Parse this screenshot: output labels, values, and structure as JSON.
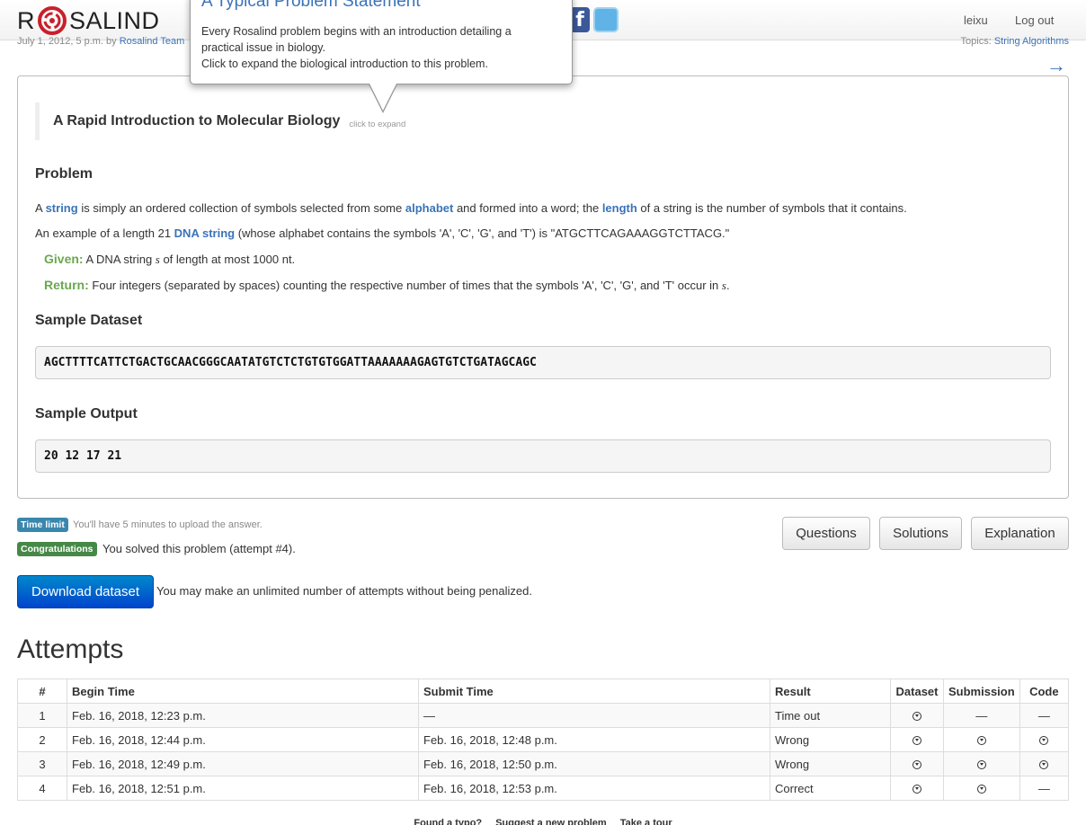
{
  "header": {
    "logo_left": "R",
    "logo_right": "SALIND",
    "user": "leixu",
    "logout": "Log out"
  },
  "meta": {
    "posted": "July 1, 2012, 5 p.m. by",
    "author": "Rosalind Team",
    "topics_label": "Topics:",
    "topics": "String Algorithms",
    "next_arrow": "→"
  },
  "tooltip": {
    "title": "A Typical Problem Statement",
    "line1": "Every Rosalind problem begins with an introduction detailing a",
    "line2": "practical issue in biology.",
    "line3": "Click to expand the biological introduction to this problem."
  },
  "problem": {
    "intro_title": "A Rapid Introduction to Molecular Biology",
    "intro_hint": "click to expand",
    "heading": "Problem",
    "p1": {
      "t1": "A ",
      "k1": "string",
      "t2": " is simply an ordered collection of symbols selected from some ",
      "k2": "alphabet",
      "t3": " and formed into a word; the ",
      "k3": "length",
      "t4": " of a string is the number of symbols that it contains."
    },
    "p2": {
      "t1": "An example of a length 21 ",
      "k1": "DNA string",
      "t2": " (whose alphabet contains the symbols 'A', 'C', 'G', and 'T') is \"ATGCTTCAGAAAGGTCTTACG.\""
    },
    "given_label": "Given:",
    "given_t1": " A DNA string ",
    "given_var": "s",
    "given_t2": " of length at most 1000 nt.",
    "return_label": "Return:",
    "return_t1": " Four integers (separated by spaces) counting the respective number of times that the symbols 'A', 'C', 'G', and 'T' occur in ",
    "return_var": "s",
    "return_t2": ".",
    "sample_dataset_heading": "Sample Dataset",
    "sample_dataset": "AGCTTTTCATTCTGACTGCAACGGGCAATATGTCTCTGTGTGGATTAAAAAAAGAGTGTCTGATAGCAGC",
    "sample_output_heading": "Sample Output",
    "sample_output": "20 12 17 21"
  },
  "status": {
    "time_limit_label": "Time limit",
    "time_limit_note": "You'll have 5 minutes to upload the answer.",
    "congrats_label": "Congratulations",
    "congrats_text": "You solved this problem (attempt #4)."
  },
  "buttons": {
    "questions": "Questions",
    "solutions": "Solutions",
    "explanation": "Explanation",
    "download": "Download dataset",
    "download_note": "You may make an unlimited number of attempts without being penalized."
  },
  "attempts": {
    "title": "Attempts",
    "headers": [
      "#",
      "Begin Time",
      "Submit Time",
      "Result",
      "Dataset",
      "Submission",
      "Code"
    ],
    "rows": [
      {
        "n": "1",
        "begin": "Feb. 16, 2018, 12:23 p.m.",
        "submit": "—",
        "result": "Time out",
        "submission": "—",
        "code": "—"
      },
      {
        "n": "2",
        "begin": "Feb. 16, 2018, 12:44 p.m.",
        "submit": "Feb. 16, 2018, 12:48 p.m.",
        "result": "Wrong",
        "submission": "",
        "code": ""
      },
      {
        "n": "3",
        "begin": "Feb. 16, 2018, 12:49 p.m.",
        "submit": "Feb. 16, 2018, 12:50 p.m.",
        "result": "Wrong",
        "submission": "",
        "code": ""
      },
      {
        "n": "4",
        "begin": "Feb. 16, 2018, 12:51 p.m.",
        "submit": "Feb. 16, 2018, 12:53 p.m.",
        "result": "Correct",
        "submission": "",
        "code": "—"
      }
    ]
  },
  "footer": {
    "typo": "Found a typo?",
    "suggest": "Suggest a new problem",
    "tour": "Take a tour"
  }
}
